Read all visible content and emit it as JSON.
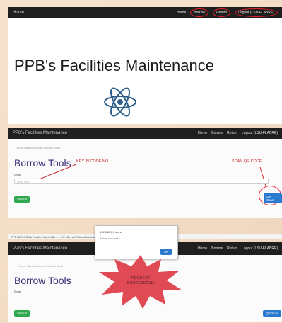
{
  "top_nav": {
    "brand": "Home",
    "items": [
      "Home",
      "Borrow",
      "Return",
      "Logout (LSU-FLABRE)"
    ]
  },
  "hero": {
    "title": "PPB's Facilities Maintenance"
  },
  "nav2": {
    "brand": "PPB's Facilities Maintenance",
    "items": [
      "Home",
      "Borrow",
      "Return",
      "Logout (LSU-FLABRE)"
    ]
  },
  "borrow_section": {
    "breadcrumb": "Home / Maintenance / Borrow Tools",
    "heading": "Borrow Tools",
    "field_label": "Email",
    "input_placeholder": "Email Here",
    "submit_label": "Submit",
    "qr_label": "QR Scan",
    "annot_key_in": "KEY IN CODE NO.",
    "annot_scan": "SCAN QR CODE"
  },
  "browser_bar": {
    "text": "PPB FACILITIES ▸ Facilities Maint. ▸ Bo ... ▸ 192.168... ▸ ITC/AvantiAdmin ▸ TFS"
  },
  "nav3": {
    "brand": "PPB's Facilities Maintenance",
    "items": [
      "Home",
      "Borrow",
      "Return",
      "Logout (LSU-FLABRE)"
    ]
  },
  "dialog": {
    "title": "192.168.5.3 says:",
    "message": "Borrow successful",
    "ok_label": "OK"
  },
  "bottom_section": {
    "breadcrumb": "Home / Maintenance / Borrow Tools",
    "heading": "Borrow Tools",
    "field_label": "Email",
    "submit_label": "Submit",
    "qr_label": "QR Scan",
    "starburst_text": "REQUEST SUCCESSFUL!"
  },
  "colors": {
    "nav_bg": "#1f1f1f",
    "annotation": "#c9272d",
    "heading": "#3b2b78",
    "green_button": "#2fa84f",
    "blue_button": "#2a7ad0",
    "starburst": "#e04a55"
  }
}
